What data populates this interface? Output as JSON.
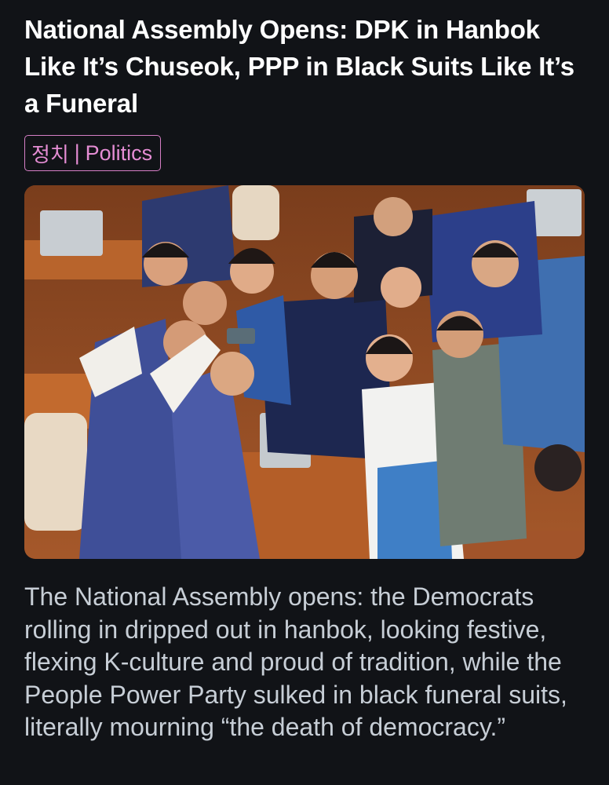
{
  "article": {
    "title": "National Assembly Opens: DPK in Hanbok Like It’s Chuseok, PPP in Black Suits Like It’s a Funeral",
    "category": {
      "korean": "정치",
      "separator": "|",
      "english": "Politics",
      "color": "#d67fc6"
    },
    "body": "The National Assembly opens: the Democrats rolling in dripped out in hanbok, looking festive, flexing K-culture and proud of tradition, while the People Power Party sulked in black funeral suits, literally mourning “the death of democracy.”"
  },
  "theme": {
    "background": "#111317",
    "title_color": "#ffffff",
    "body_color": "#c7ced6"
  }
}
